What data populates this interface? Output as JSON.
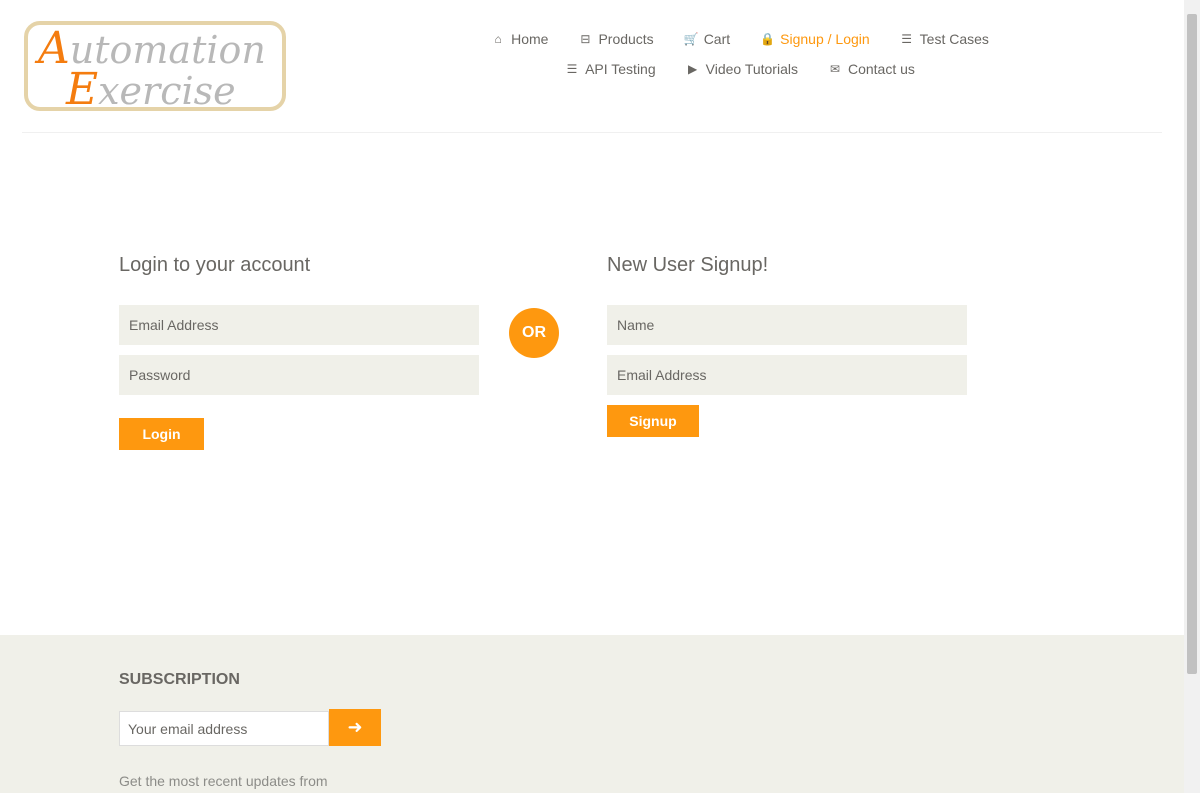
{
  "logo": {
    "line1_cap": "A",
    "line1_rest": "utomation",
    "line2_cap": "E",
    "line2_rest": "xercise"
  },
  "nav": [
    {
      "label": "Home",
      "icon": "home-icon",
      "glyph": "⌂"
    },
    {
      "label": "Products",
      "icon": "briefcase-icon",
      "glyph": "⊟"
    },
    {
      "label": "Cart",
      "icon": "cart-icon",
      "glyph": "🛒"
    },
    {
      "label": "Signup / Login",
      "icon": "lock-icon",
      "glyph": "🔒"
    },
    {
      "label": "Test Cases",
      "icon": "list-icon",
      "glyph": "☰"
    },
    {
      "label": "API Testing",
      "icon": "list-icon",
      "glyph": "☰"
    },
    {
      "label": "Video Tutorials",
      "icon": "youtube-play-icon",
      "glyph": "▶"
    },
    {
      "label": "Contact us",
      "icon": "envelope-icon",
      "glyph": "✉"
    }
  ],
  "login": {
    "title": "Login to your account",
    "email_placeholder": "Email Address",
    "password_placeholder": "Password",
    "button": "Login"
  },
  "or_label": "OR",
  "signup": {
    "title": "New User Signup!",
    "name_placeholder": "Name",
    "email_placeholder": "Email Address",
    "button": "Signup"
  },
  "footer": {
    "title": "SUBSCRIPTION",
    "email_placeholder": "Your email address",
    "button_glyph": "➜",
    "text": "Get the most recent updates from"
  },
  "colors": {
    "accent": "#FE980F",
    "input_bg": "#F0F0E9"
  }
}
